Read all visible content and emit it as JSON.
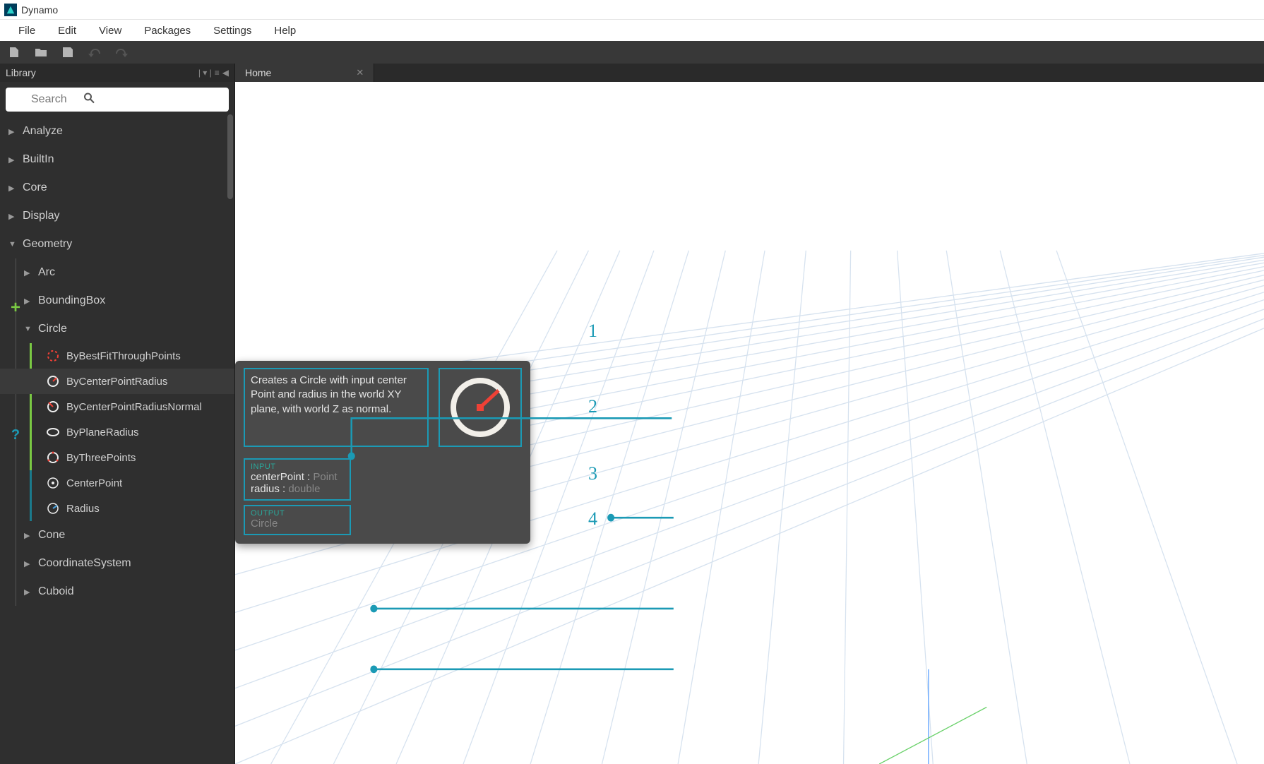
{
  "window": {
    "title": "Dynamo"
  },
  "menubar": {
    "items": [
      "File",
      "Edit",
      "View",
      "Packages",
      "Settings",
      "Help"
    ]
  },
  "library": {
    "title": "Library",
    "search_placeholder": "Search",
    "categories": {
      "analyze": "Analyze",
      "builtin": "BuiltIn",
      "core": "Core",
      "display": "Display",
      "geometry": "Geometry",
      "cone": "Cone",
      "coordsys": "CoordinateSystem",
      "cuboid": "Cuboid"
    },
    "geometry_children": {
      "arc": "Arc",
      "boundingbox": "BoundingBox",
      "circle": "Circle"
    },
    "circle_nodes": {
      "bybestfit": "ByBestFitThroughPoints",
      "bycenterpointradius": "ByCenterPointRadius",
      "bycenterpointradiusnormal": "ByCenterPointRadiusNormal",
      "byplaneradius": "ByPlaneRadius",
      "bythreepoints": "ByThreePoints",
      "centerpoint": "CenterPoint",
      "radius": "Radius"
    }
  },
  "tabs": {
    "home": "Home"
  },
  "tooltip": {
    "description": "Creates a Circle with input center Point and radius in the world XY plane, with world Z as normal.",
    "input_title": "INPUT",
    "inputs": [
      {
        "name": "centerPoint",
        "type": "Point"
      },
      {
        "name": "radius",
        "type": "double"
      }
    ],
    "output_title": "OUTPUT",
    "output": "Circle"
  },
  "annotations": {
    "n1": "1",
    "n2": "2",
    "n3": "3",
    "n4": "4"
  }
}
